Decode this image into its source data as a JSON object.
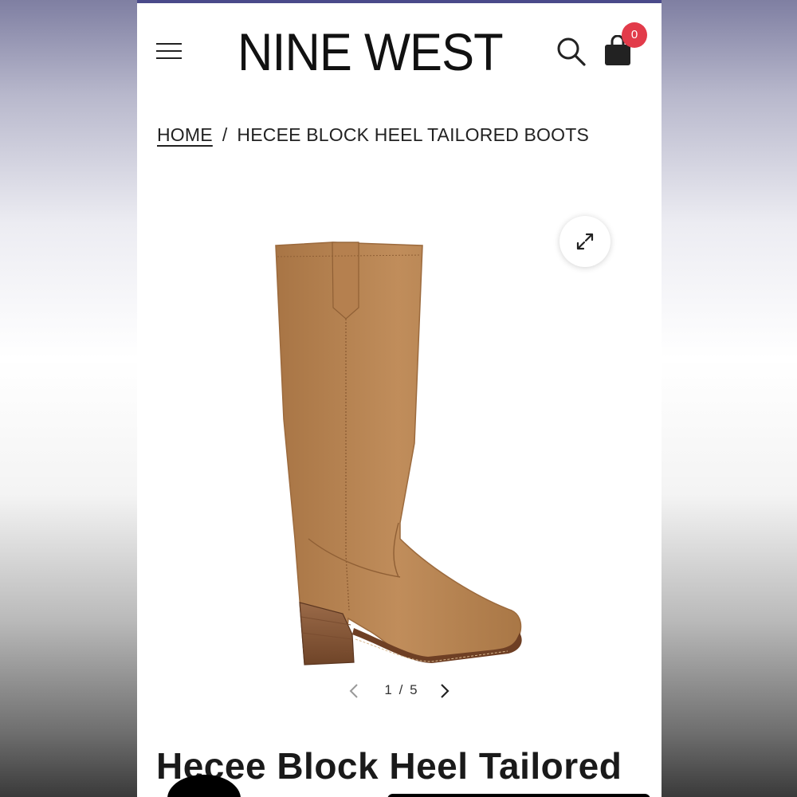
{
  "header": {
    "logo": "NINE WEST",
    "menu_icon": "hamburger-icon",
    "search_icon": "search-icon",
    "cart_icon": "shopping-bag-icon",
    "cart_count": "0"
  },
  "breadcrumb": {
    "home": "HOME",
    "separator": "/",
    "current": "HECEE BLOCK HEEL TAILORED BOOTS"
  },
  "gallery": {
    "expand_icon": "expand-icon",
    "current": "1",
    "separator": "/",
    "total": "5",
    "prev_icon": "chevron-left-icon",
    "next_icon": "chevron-right-icon"
  },
  "product": {
    "title": "Hecee Block Heel Tailored"
  },
  "colors": {
    "accent_badge": "#e23b4a",
    "boot_suede": "#b98654",
    "heel_wood": "#8a5a3a"
  }
}
